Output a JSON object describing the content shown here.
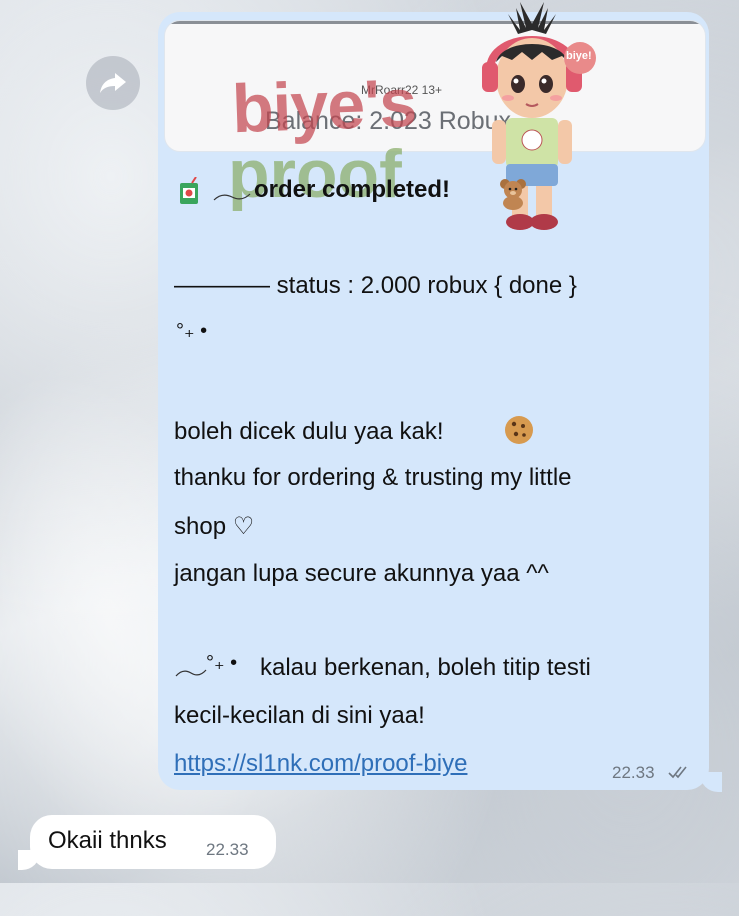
{
  "forward_icon": "forward-arrow-icon",
  "image_preview": {
    "username": "MrRoarr22 13+",
    "balance": "Balance: 2.023 Robux"
  },
  "watermark": {
    "line1": "biye's",
    "line2": "proof",
    "badge": "biye!"
  },
  "outgoing_message": {
    "order_title": "order completed!",
    "status": "———— status : 2.000 robux { done }",
    "decor": "°₊ •",
    "line1": "boleh dicek dulu yaa kak!",
    "line2": "thanku for ordering & trusting my little",
    "line3": "shop ♡",
    "line4": "jangan lupa secure akunnya yaa ^^",
    "line5": "kalau berkenan, boleh titip testi",
    "line6": "kecil-kecilan di sini yaa!",
    "link": "https://sl1nk.com/proof-biye",
    "time": "22.33"
  },
  "incoming_message": {
    "text": "Okaii thnks",
    "time": "22.33"
  },
  "icons": {
    "juice": "juice-box-icon",
    "bear": "teddy-bear-icon",
    "cookie": "cookie-icon",
    "read_receipt": "double-check-icon"
  },
  "colors": {
    "outgoing_bubble": "#d5e7fb",
    "incoming_bubble": "#ffffff",
    "link": "#2f6fb8"
  }
}
